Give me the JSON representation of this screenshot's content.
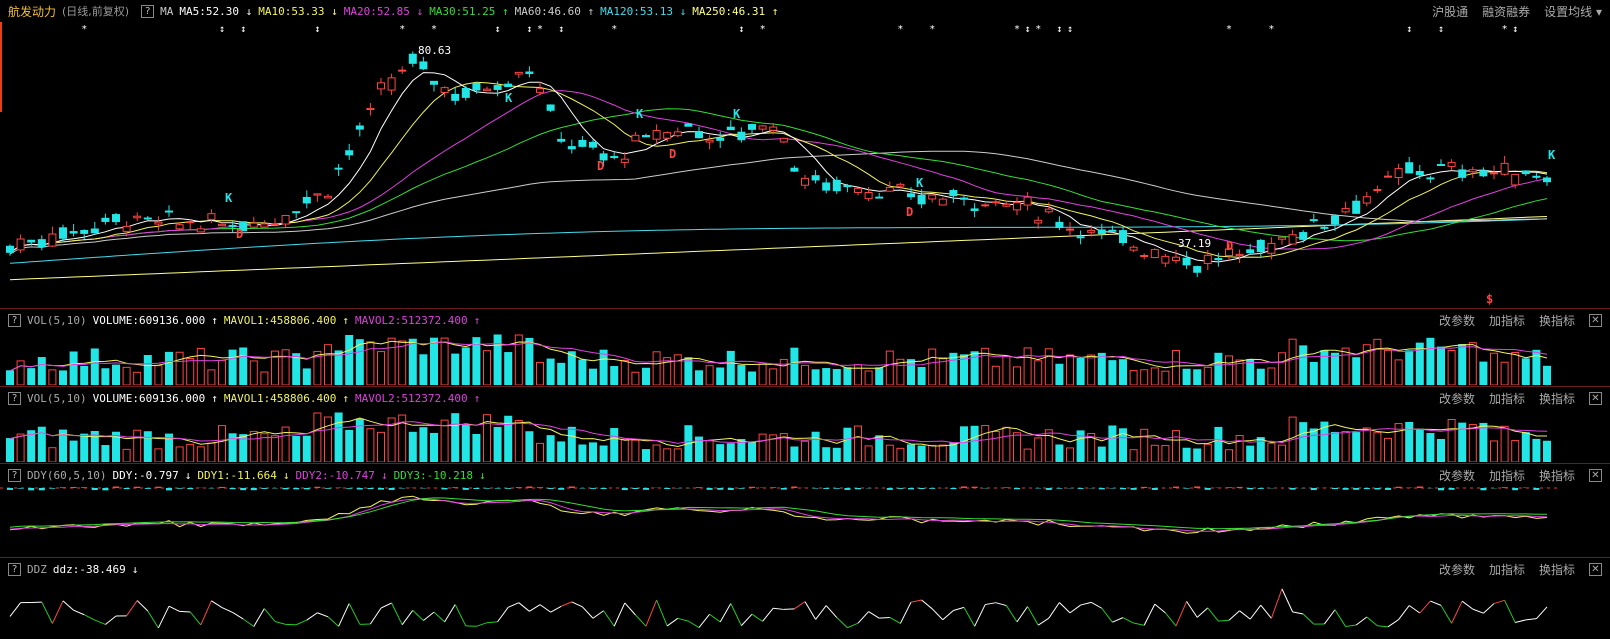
{
  "header": {
    "stock_name": "航发动力",
    "period": "(日线,前复权)",
    "ma_label": "MA",
    "ma_items": [
      {
        "label": "MA5:52.30",
        "arrow": "↓",
        "color": "#ffffff"
      },
      {
        "label": "MA10:53.33",
        "arrow": "↓",
        "color": "#f3f35a"
      },
      {
        "label": "MA20:52.85",
        "arrow": "↓",
        "color": "#e040e0"
      },
      {
        "label": "MA30:51.25",
        "arrow": "↑",
        "color": "#33dd33"
      },
      {
        "label": "MA60:46.60",
        "arrow": "↑",
        "color": "#cccccc"
      },
      {
        "label": "MA120:53.13",
        "arrow": "↓",
        "color": "#44ddee"
      },
      {
        "label": "MA250:46.31",
        "arrow": "↑",
        "color": "#ffff88"
      }
    ],
    "right_links": [
      "沪股通",
      "融资融券",
      "设置均线"
    ]
  },
  "price_annotations": {
    "high": "80.63",
    "low": "37.19"
  },
  "vol_panel": {
    "name": "VOL(5,10)",
    "volume": "VOLUME:609136.000",
    "mavol1": "MAVOL1:458806.400",
    "mavol2": "MAVOL2:512372.400",
    "up": "↑"
  },
  "ddy_panel": {
    "name": "DDY(60,5,10)",
    "ddy": "DDY:-0.797",
    "ddy_arrow": "↓",
    "ddy1": "DDY1:-11.664",
    "ddy1_arrow": "↓",
    "ddy2": "DDY2:-10.747",
    "ddy2_arrow": "↓",
    "ddy3": "DDY3:-10.218",
    "ddy3_arrow": "↓"
  },
  "ddz_panel": {
    "name": "DDZ",
    "ddz": "ddz:-38.469",
    "arrow": "↓"
  },
  "panel_buttons": {
    "edit": "改参数",
    "add": "加指标",
    "swap": "换指标",
    "close": "✕",
    "help": "?"
  },
  "colors": {
    "up": "#ff4444",
    "down": "#22e6e6",
    "bg": "#000000",
    "panel_border": "#6a1c1c"
  },
  "chart_data": {
    "type": "candlestick",
    "title": "航发动力 (日线,前复权)",
    "price_max": 80.63,
    "price_min": 37.19,
    "series_ma": [
      "MA5",
      "MA10",
      "MA20",
      "MA30",
      "MA60",
      "MA120",
      "MA250"
    ]
  }
}
